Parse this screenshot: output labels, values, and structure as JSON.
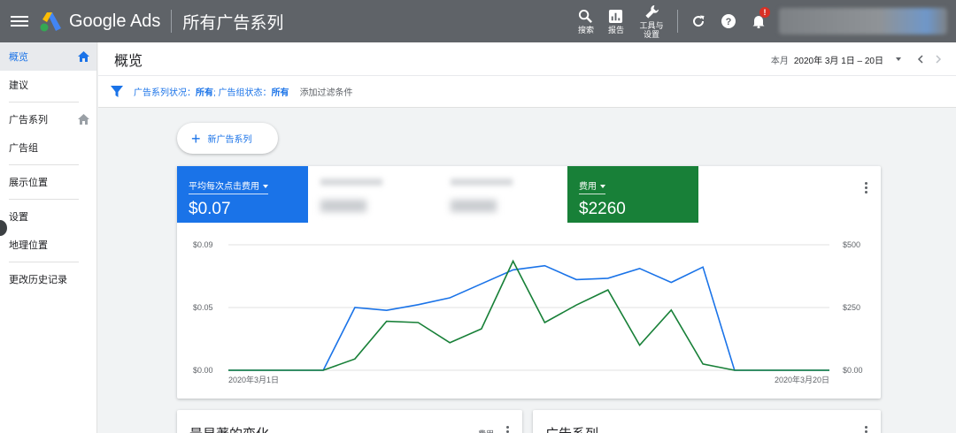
{
  "topbar": {
    "brand": "Google Ads",
    "context": "所有广告系列",
    "tools": [
      {
        "icon": "search-icon",
        "label": "搜索"
      },
      {
        "icon": "reports-icon",
        "label": "报告"
      },
      {
        "icon": "wrench-icon",
        "label": "工具与设置"
      }
    ],
    "notification_badge": "!"
  },
  "sidebar": {
    "items": [
      {
        "label": "概览",
        "active": true,
        "home": true
      },
      {
        "label": "建议"
      },
      {
        "label": "广告系列",
        "home": true
      },
      {
        "label": "广告组"
      },
      {
        "label": "展示位置"
      },
      {
        "label": "设置"
      },
      {
        "label": "地理位置"
      },
      {
        "label": "更改历史记录"
      }
    ]
  },
  "header": {
    "title": "概览",
    "date_preset": "本月",
    "date_range": "2020年 3月 1日 – 20日"
  },
  "filter": {
    "campaign_status_label": "广告系列状况：",
    "campaign_status_value": "所有",
    "adgroup_status_label": "; 广告组状态：",
    "adgroup_status_value": "所有",
    "add_filter": "添加过滤条件"
  },
  "new_campaign_label": "新广告系列",
  "metrics": {
    "left": {
      "label": "平均每次点击费用",
      "value": "$0.07",
      "color": "#1a73e8"
    },
    "right": {
      "label": "费用",
      "value": "$2260",
      "color": "#188038"
    }
  },
  "chart_data": {
    "type": "line",
    "x": [
      "2020年3月1日",
      "",
      "",
      "",
      "",
      "",
      "",
      "",
      "",
      "",
      "",
      "",
      "",
      "",
      "",
      "",
      "",
      "",
      "",
      "2020年3月20日"
    ],
    "series": [
      {
        "name": "平均每次点击费用",
        "axis": "left",
        "color": "#1a73e8",
        "values": [
          0,
          0,
          0,
          0,
          0.045,
          0.043,
          0.047,
          0.052,
          0.062,
          0.072,
          0.075,
          0.065,
          0.066,
          0.073,
          0.063,
          0.074,
          0,
          0,
          0,
          0
        ]
      },
      {
        "name": "费用",
        "axis": "right",
        "color": "#188038",
        "values": [
          0,
          0,
          0,
          0,
          45,
          195,
          190,
          110,
          165,
          435,
          190,
          260,
          320,
          100,
          240,
          25,
          0,
          0,
          0,
          0
        ]
      }
    ],
    "y_left": {
      "min": 0,
      "max": 0.09,
      "ticks": [
        "$0.00",
        "$0.05",
        "$0.09"
      ]
    },
    "y_right": {
      "min": 0,
      "max": 500,
      "ticks": [
        "$0.00",
        "$250",
        "$500"
      ]
    },
    "grid": true
  },
  "bottom_cards": {
    "left_title": "最显著的变化",
    "left_metric": "费用",
    "right_title": "广告系列"
  }
}
